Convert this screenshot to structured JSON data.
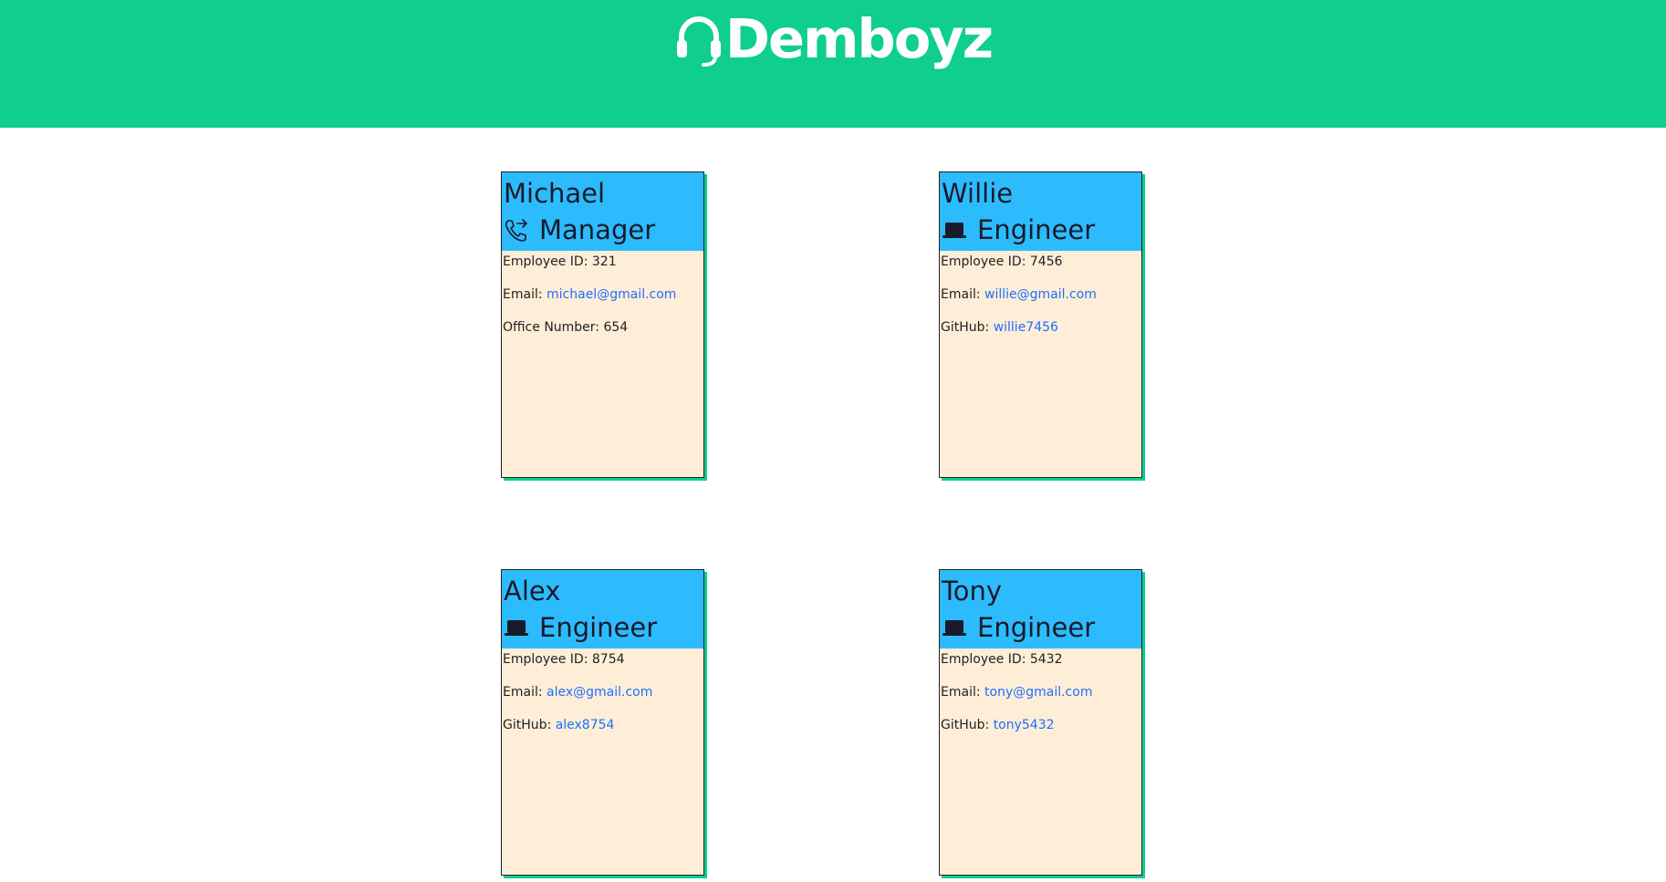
{
  "brand": {
    "name": "Demboyz",
    "icon": "headset-icon"
  },
  "colors": {
    "header_bg": "#0fce8e",
    "card_head_bg": "#2cbcfe",
    "card_body_bg": "#feeed8",
    "link": "#1f6fff"
  },
  "employees": [
    {
      "name": "Michael",
      "role": "Manager",
      "role_icon": "phone-forward-icon",
      "id_label": "Employee ID:",
      "id": "321",
      "email_label": "Email:",
      "email": "michael@gmail.com",
      "extra_label": "Office Number:",
      "extra": "654"
    },
    {
      "name": "Willie",
      "role": "Engineer",
      "role_icon": "laptop-icon",
      "id_label": "Employee ID:",
      "id": "7456",
      "email_label": "Email:",
      "email": "willie@gmail.com",
      "extra_label": "GitHub:",
      "extra": "willie7456"
    },
    {
      "name": "Alex",
      "role": "Engineer",
      "role_icon": "laptop-icon",
      "id_label": "Employee ID:",
      "id": "8754",
      "email_label": "Email:",
      "email": "alex@gmail.com",
      "extra_label": "GitHub:",
      "extra": "alex8754"
    },
    {
      "name": "Tony",
      "role": "Engineer",
      "role_icon": "laptop-icon",
      "id_label": "Employee ID:",
      "id": "5432",
      "email_label": "Email:",
      "email": "tony@gmail.com",
      "extra_label": "GitHub:",
      "extra": "tony5432"
    }
  ]
}
